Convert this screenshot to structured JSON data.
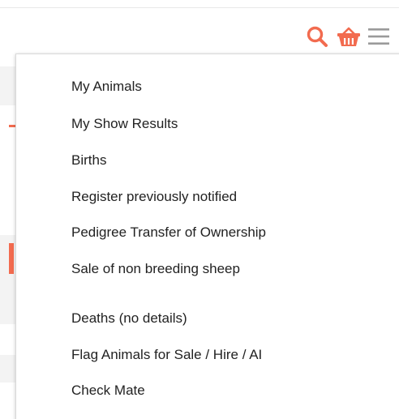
{
  "header": {
    "icons": [
      {
        "name": "search-icon",
        "color": "#f26b4f"
      },
      {
        "name": "basket-icon",
        "color": "#f26b4f"
      },
      {
        "name": "hamburger-menu-icon",
        "color": "#9a9a9a"
      }
    ]
  },
  "menu": {
    "items": [
      {
        "label": "My Animals"
      },
      {
        "label": "My Show Results"
      },
      {
        "label": "Births"
      },
      {
        "label": "Register previously notified"
      },
      {
        "label": "Pedigree Transfer of Ownership"
      },
      {
        "label": "Sale of non breeding sheep"
      },
      {
        "label": "Deaths (no details)"
      },
      {
        "label": "Flag Animals for Sale / Hire / AI"
      },
      {
        "label": "Check Mate"
      }
    ]
  },
  "colors": {
    "accent": "#f26b4f",
    "menu_text": "#222222",
    "menu_icon": "#9a9a9a"
  }
}
